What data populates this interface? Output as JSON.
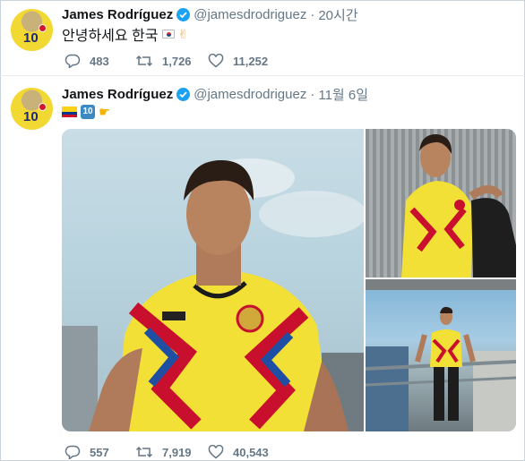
{
  "tweets": [
    {
      "author_name": "James Rodríguez",
      "handle": "@jamesdrodriguez",
      "separator": "·",
      "time": "20시간",
      "text": "안녕하세요 한국",
      "emojis": [
        "flag-south-korea",
        "victory-hand"
      ],
      "avatar_number": "10",
      "actions": {
        "replies": "483",
        "retweets": "1,726",
        "likes": "11,252"
      }
    },
    {
      "author_name": "James Rodríguez",
      "handle": "@jamesdrodriguez",
      "separator": "·",
      "time": "11월 6일",
      "text": "",
      "emojis": [
        "flag-colombia",
        "keycap-ten",
        "backhand-index-pointing-right"
      ],
      "keycap_label": "10",
      "avatar_number": "10",
      "media": [
        {
          "name": "photo-main-yellow-jersey"
        },
        {
          "name": "photo-top-right-seated"
        },
        {
          "name": "photo-bottom-right-standing"
        }
      ],
      "actions": {
        "replies": "557",
        "retweets": "7,919",
        "likes": "40,543"
      }
    }
  ],
  "colors": {
    "verified": "#1da1f2",
    "secondary_text": "#657786",
    "jersey_yellow": "#f2e036",
    "jersey_red": "#c8102e",
    "jersey_blue": "#1f4fa3"
  }
}
